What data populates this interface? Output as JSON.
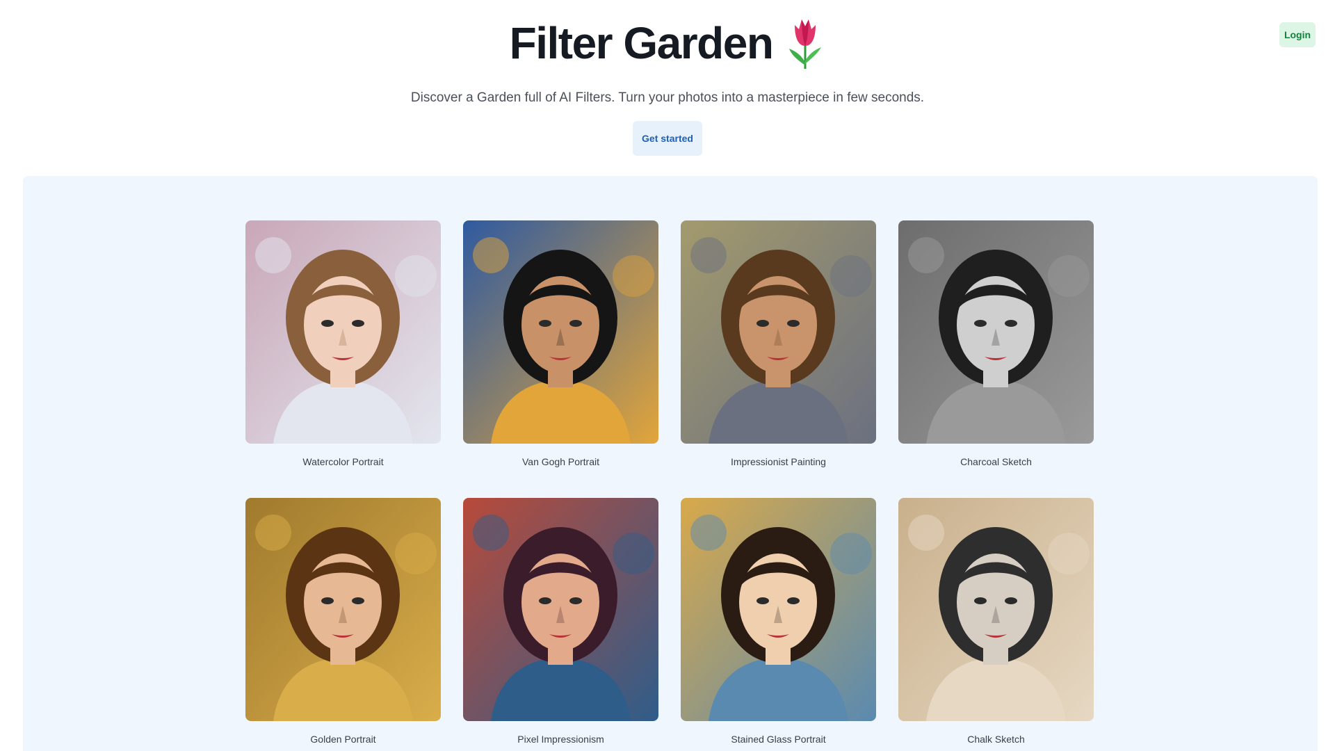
{
  "header": {
    "login_label": "Login"
  },
  "hero": {
    "title": "Filter Garden",
    "emoji_icon": "tulip-icon",
    "subtitle": "Discover a Garden full of AI Filters. Turn your photos into a masterpiece in few seconds.",
    "cta_label": "Get started"
  },
  "gallery": {
    "filters": [
      {
        "label": "Watercolor Portrait",
        "bg": "#c9a7b8",
        "accent": "#e3e6ee",
        "hair": "#8a5f3c",
        "skin": "#f0d0bd"
      },
      {
        "label": "Van Gogh Portrait",
        "bg": "#2f5aa0",
        "accent": "#e2a53a",
        "hair": "#151515",
        "skin": "#c99168"
      },
      {
        "label": "Impressionist Painting",
        "bg": "#a39a6d",
        "accent": "#6b7080",
        "hair": "#5a3a1f",
        "skin": "#c9946b"
      },
      {
        "label": "Charcoal Sketch",
        "bg": "#6d6d6d",
        "accent": "#9a9a9a",
        "hair": "#1f1f1f",
        "skin": "#cfcfcf"
      },
      {
        "label": "Golden Portrait",
        "bg": "#a07a2e",
        "accent": "#d9ad4a",
        "hair": "#5b3414",
        "skin": "#e6b994"
      },
      {
        "label": "Pixel Impressionism",
        "bg": "#b84a3a",
        "accent": "#2f5d8a",
        "hair": "#3a1c2a",
        "skin": "#e2a98a"
      },
      {
        "label": "Stained Glass Portrait",
        "bg": "#d9a94a",
        "accent": "#5a8ab0",
        "hair": "#2a1c12",
        "skin": "#efcfae"
      },
      {
        "label": "Chalk Sketch",
        "bg": "#c9b08c",
        "accent": "#e6d8c3",
        "hair": "#2e2e2e",
        "skin": "#d6cdc3"
      }
    ]
  }
}
